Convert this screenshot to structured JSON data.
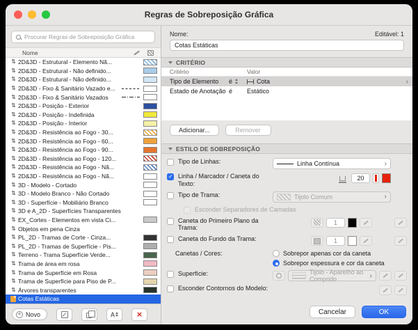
{
  "window": {
    "title": "Regras de Sobreposição Gráfica"
  },
  "icons": {
    "updown_arrows": "⇅"
  },
  "left": {
    "search_placeholder": "Procurar Regras de Sobreposição Gráfica",
    "name_column": "Nome",
    "toolbar": {
      "new": "Novo"
    },
    "items": [
      {
        "label": "2D&3D - Estrutural - Elemento Nã...",
        "swatch": {
          "pattern": "hatch",
          "color": "#7fb2d9"
        }
      },
      {
        "label": "2D&3D - Estrutural - Não definido...",
        "swatch": {
          "pattern": "solid",
          "color": "#a9cde9"
        }
      },
      {
        "label": "2D&3D - Estrutural - Não definido...",
        "swatch": {
          "pattern": "solid",
          "color": "#d2e6f5"
        }
      },
      {
        "label": "2D&3D - Fixo & Sanitário Vazado e...",
        "line": "dashed",
        "swatch": {
          "pattern": "solid",
          "color": "#ffffff"
        }
      },
      {
        "label": "2D&3D - Fixo & Sanitário Vazados",
        "line": "dashdot",
        "swatch": {
          "pattern": "solid",
          "color": "#ffffff"
        }
      },
      {
        "label": "2D&3D - Posição - Exterior",
        "swatch": {
          "pattern": "solid",
          "color": "#2c4f9f"
        }
      },
      {
        "label": "2D&3D - Posição - Indefinida",
        "swatch": {
          "pattern": "solid",
          "color": "#f1e83b"
        }
      },
      {
        "label": "2D&3D - Posição - Interior",
        "swatch": {
          "pattern": "solid",
          "color": "#f5f0a6"
        }
      },
      {
        "label": "2D&3D - Resistência ao Fogo - 30...",
        "swatch": {
          "pattern": "hatch",
          "color": "#eda83b"
        }
      },
      {
        "label": "2D&3D - Resistência ao Fogo - 60...",
        "swatch": {
          "pattern": "solid",
          "color": "#f0a33a"
        }
      },
      {
        "label": "2D&3D - Resistência ao Fogo - 90...",
        "swatch": {
          "pattern": "solid",
          "color": "#e6762d"
        }
      },
      {
        "label": "2D&3D - Resistência ao Fogo - 120...",
        "swatch": {
          "pattern": "hatch",
          "color": "#c43b27"
        }
      },
      {
        "label": "2D&3D - Resistência ao Fogo - Nã...",
        "swatch": {
          "pattern": "hatch",
          "color": "#4f7ec2"
        }
      },
      {
        "label": "2D&3D - Resistência ao Fogo - Nã...",
        "swatch": {
          "pattern": "solid",
          "color": "#ffffff"
        }
      },
      {
        "label": "3D - Modelo - Cortado",
        "swatch": {
          "pattern": "solid",
          "color": "#ffffff"
        }
      },
      {
        "label": "3D - Modelo Branco - Não Cortado",
        "swatch": {
          "pattern": "solid",
          "color": "#ffffff"
        }
      },
      {
        "label": "3D - Superfície - Mobiliário Branco",
        "swatch": {
          "pattern": "solid",
          "color": "#ffffff"
        }
      },
      {
        "label": "3D e A_2D - Superfícies Transparentes",
        "swatch": null
      },
      {
        "label": "EX_Cortes - Elementos em vista Ci...",
        "swatch": {
          "pattern": "solid",
          "color": "#c9c9c9"
        }
      },
      {
        "label": "Objetos em pena Cinza",
        "swatch": null
      },
      {
        "label": "PL_2D - Tramas de Corte - Cinza...",
        "swatch": {
          "pattern": "solid",
          "color": "#333333"
        }
      },
      {
        "label": "PL_2D - Tramas de Superfície - Pis...",
        "swatch": {
          "pattern": "solid",
          "color": "#aeaeae"
        }
      },
      {
        "label": "Terreno - Trama Superfície Verde...",
        "swatch": {
          "pattern": "solid",
          "color": "#4a654d"
        }
      },
      {
        "label": "Trama de área em rosa",
        "swatch": {
          "pattern": "solid",
          "color": "#f2b9c5"
        }
      },
      {
        "label": "Trama de Superfície em Rosa",
        "swatch": {
          "pattern": "solid",
          "color": "#eccfc2"
        }
      },
      {
        "label": "Trama de Superfície para Piso de P...",
        "swatch": {
          "pattern": "solid",
          "color": "#e5d5ad"
        }
      },
      {
        "label": "Árvores transparentes",
        "swatch": {
          "pattern": "solid",
          "color": "#26332a"
        }
      },
      {
        "label": "Cotas Estáticas",
        "selected": true,
        "icon": "rule-doc",
        "swatch": null
      }
    ]
  },
  "right": {
    "name_label": "Nome:",
    "editable": "Editável: 1",
    "name_value": "Cotas Estáticas",
    "criteria": {
      "title": "CRITÉRIO",
      "columns": {
        "criterion": "Critério",
        "value": "Valor"
      },
      "rows": [
        {
          "criterion": "Tipo de Elemento",
          "operator": "é",
          "value": "Cota",
          "selected": true,
          "icon": "dimension"
        },
        {
          "criterion": "Estado de Anotação",
          "operator": "é",
          "value": "Estático",
          "selected": false
        }
      ],
      "add": "Adicionar...",
      "remove": "Remover"
    },
    "style": {
      "title": "ESTILO DE SOBREPOSIÇÃO",
      "rows": {
        "line_type": {
          "label": "Tipo de Linhas:",
          "value": "Linha Contínua",
          "checked": false
        },
        "pen": {
          "label": "Linha / Marcador / Caneta do Texto:",
          "value": "20",
          "color": "#e8220a",
          "checked": true
        },
        "fill_type": {
          "label": "Tipo de Trama:",
          "value": "Tijolo Comum",
          "checked": false
        },
        "hide_layer_separators": {
          "label": "Esconder Separadores de Camadas",
          "checked": false
        },
        "fg_pen": {
          "label": "Caneta do Primeiro Plano da Trama:",
          "value": "1",
          "color": "#000000",
          "checked": false
        },
        "bg_pen": {
          "label": "Caneta do Fundo da Trama:",
          "value": "1",
          "color": "#ffffff",
          "checked": false
        },
        "pens_colors": {
          "label": "Canetas / Cores:",
          "options": [
            "Sobrepor apenas cor da caneta",
            "Sobrepor espessura e cor da caneta"
          ],
          "selected": 1
        },
        "surface": {
          "label": "Superfície:",
          "value": "Tijolo - Aparelho ao Comprido",
          "checked": false
        },
        "hide_contours": {
          "label": "Esconder Contornos do Modelo:",
          "checked": false
        }
      }
    },
    "actions": {
      "cancel": "Cancelar",
      "ok": "OK"
    }
  }
}
